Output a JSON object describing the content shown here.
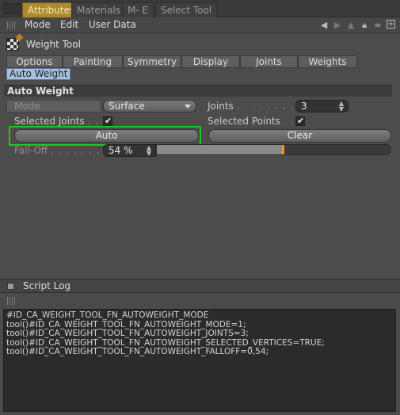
{
  "tabs": [
    {
      "label": "Attributes",
      "active": true
    },
    {
      "label": "Materials",
      "active": false
    },
    {
      "label": "M- E",
      "active": false
    },
    {
      "label": "Select Tool",
      "active": false
    }
  ],
  "menu": [
    "Mode",
    "Edit",
    "User Data"
  ],
  "nav_icons": [
    "arrow-left-icon",
    "arrow-right-icon",
    "up-arrow-icon",
    "lock-icon",
    "link-icon",
    "new-panel-icon"
  ],
  "tool": {
    "title": "Weight Tool",
    "icon": "weight-tool-icon"
  },
  "subtabs": [
    "Options",
    "Painting",
    "Symmetry",
    "Display",
    "Joints",
    "Weights"
  ],
  "active_chip": "Auto Weight",
  "section_title": "Auto Weight",
  "fields": {
    "mode_label": "Mode",
    "mode_value": "Surface",
    "joints_label": "Joints",
    "joints_dots": ". . . . . . . . . . .",
    "joints_value": "3",
    "selected_joints_label": "Selected Joints",
    "selected_joints_dots": ". . .",
    "selected_joints_checked": true,
    "selected_points_label": "Selected Points",
    "selected_points_dots": ". .",
    "selected_points_checked": true,
    "falloff_label": "Fall-Off",
    "falloff_dots": ". . . . . . . . .",
    "falloff_value": "54 %",
    "falloff_fraction": 0.54
  },
  "buttons": {
    "auto": "Auto",
    "clear": "Clear"
  },
  "colors": {
    "accent_tab": "#ad8b2c",
    "focus_ring": "#16c82d",
    "falloff_marker": "#e39b22",
    "chip": "#a7c0e0"
  },
  "log": {
    "title": "Script Log",
    "lines": [
      "#ID_CA_WEIGHT_TOOL_FN_AUTOWEIGHT_MODE",
      "tool()#ID_CA_WEIGHT_TOOL_FN_AUTOWEIGHT_MODE=1;",
      "tool()#ID_CA_WEIGHT_TOOL_FN_AUTOWEIGHT_JOINTS=3;",
      "tool()#ID_CA_WEIGHT_TOOL_FN_AUTOWEIGHT_SELECTED_VERTICES=TRUE;",
      "tool()#ID_CA_WEIGHT_TOOL_FN_AUTOWEIGHT_FALLOFF=0,54;"
    ]
  }
}
